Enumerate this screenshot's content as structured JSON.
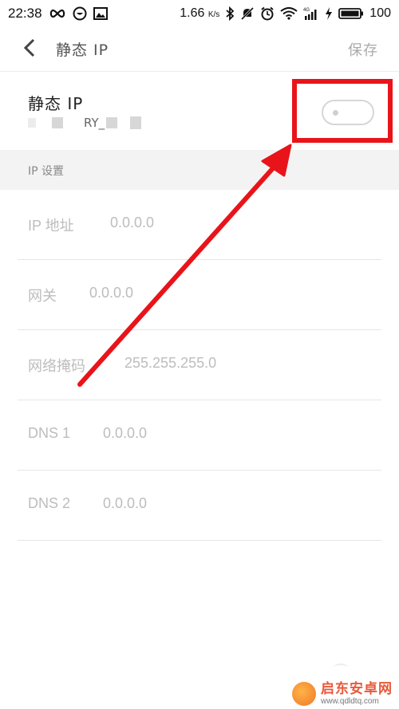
{
  "status_bar": {
    "time": "22:38",
    "network_speed": "1.66",
    "speed_unit": "K/s",
    "signal_label": "4G",
    "battery": "100"
  },
  "header": {
    "title": "静态 IP",
    "save_label": "保存"
  },
  "static_ip": {
    "title": "静态 IP",
    "network_name_visible": "RY_",
    "toggle_on": false
  },
  "section": {
    "title": "IP 设置"
  },
  "fields": [
    {
      "label": "IP 地址",
      "value": "0.0.0.0"
    },
    {
      "label": "网关",
      "value": "0.0.0.0"
    },
    {
      "label": "网络掩码",
      "value": "255.255.255.0"
    },
    {
      "label": "DNS 1",
      "value": "0.0.0.0"
    },
    {
      "label": "DNS 2",
      "value": "0.0.0.0"
    }
  ],
  "watermark": {
    "title": "启东安卓网",
    "url": "www.qdldtq.com"
  },
  "colors": {
    "annotation_red": "#e8141a",
    "text_muted": "#bdbdbd",
    "section_bg": "#f3f3f3"
  }
}
